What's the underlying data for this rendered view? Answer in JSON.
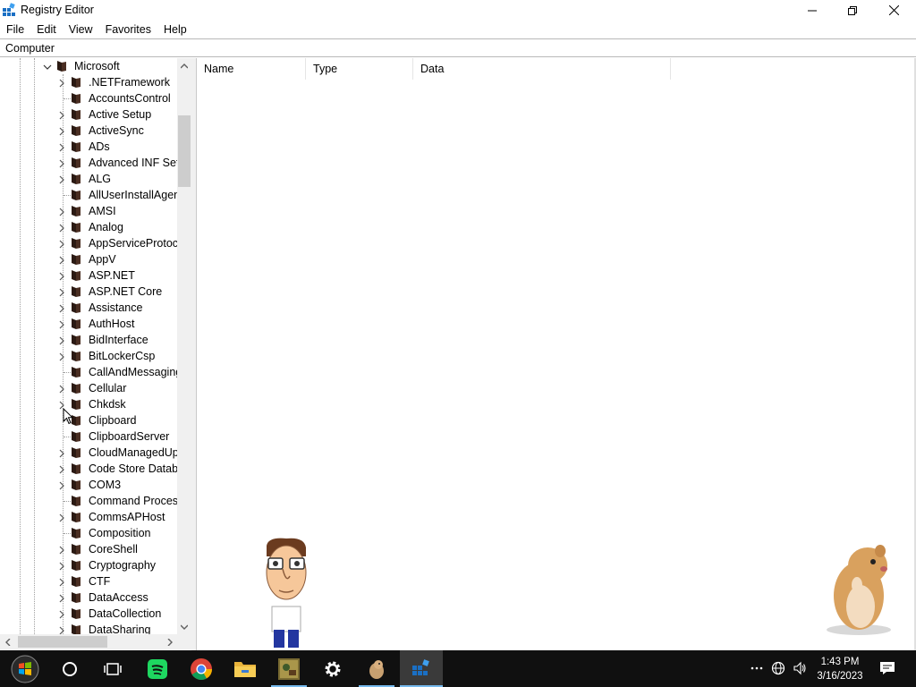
{
  "window": {
    "title": "Registry Editor"
  },
  "menu": [
    "File",
    "Edit",
    "View",
    "Favorites",
    "Help"
  ],
  "address": "Computer",
  "tree": {
    "parent": "Microsoft",
    "items": [
      {
        "label": ".NETFramework",
        "expandable": true
      },
      {
        "label": "AccountsControl",
        "expandable": false
      },
      {
        "label": "Active Setup",
        "expandable": true
      },
      {
        "label": "ActiveSync",
        "expandable": true
      },
      {
        "label": "ADs",
        "expandable": true
      },
      {
        "label": "Advanced INF Setu",
        "expandable": true
      },
      {
        "label": "ALG",
        "expandable": true
      },
      {
        "label": "AllUserInstallAgent",
        "expandable": false
      },
      {
        "label": "AMSI",
        "expandable": true
      },
      {
        "label": "Analog",
        "expandable": true
      },
      {
        "label": "AppServiceProtoco",
        "expandable": true
      },
      {
        "label": "AppV",
        "expandable": true
      },
      {
        "label": "ASP.NET",
        "expandable": true
      },
      {
        "label": "ASP.NET Core",
        "expandable": true
      },
      {
        "label": "Assistance",
        "expandable": true
      },
      {
        "label": "AuthHost",
        "expandable": true
      },
      {
        "label": "BidInterface",
        "expandable": true
      },
      {
        "label": "BitLockerCsp",
        "expandable": true
      },
      {
        "label": "CallAndMessaging",
        "expandable": false
      },
      {
        "label": "Cellular",
        "expandable": true
      },
      {
        "label": "Chkdsk",
        "expandable": true
      },
      {
        "label": "Clipboard",
        "expandable": false
      },
      {
        "label": "ClipboardServer",
        "expandable": false
      },
      {
        "label": "CloudManagedUp",
        "expandable": true
      },
      {
        "label": "Code Store Databa",
        "expandable": true
      },
      {
        "label": "COM3",
        "expandable": true
      },
      {
        "label": "Command Process",
        "expandable": false
      },
      {
        "label": "CommsAPHost",
        "expandable": true
      },
      {
        "label": "Composition",
        "expandable": false
      },
      {
        "label": "CoreShell",
        "expandable": true
      },
      {
        "label": "Cryptography",
        "expandable": true
      },
      {
        "label": "CTF",
        "expandable": true
      },
      {
        "label": "DataAccess",
        "expandable": true
      },
      {
        "label": "DataCollection",
        "expandable": true
      },
      {
        "label": "DataSharing",
        "expandable": true
      }
    ]
  },
  "list": {
    "columns": [
      "Name",
      "Type",
      "Data"
    ]
  },
  "taskbar": {
    "time": "1:43 PM",
    "date": "3/16/2023",
    "apps": [
      "start-icon",
      "cortana-icon",
      "task-view-icon",
      "spotify-icon",
      "chrome-icon",
      "file-explorer-icon",
      "game-app-icon",
      "settings-icon",
      "animal-app-icon",
      "registry-editor-icon"
    ]
  },
  "colors": {
    "folder": "#2b1a13",
    "taskbar": "#101010",
    "accent": "#76b9ed"
  }
}
